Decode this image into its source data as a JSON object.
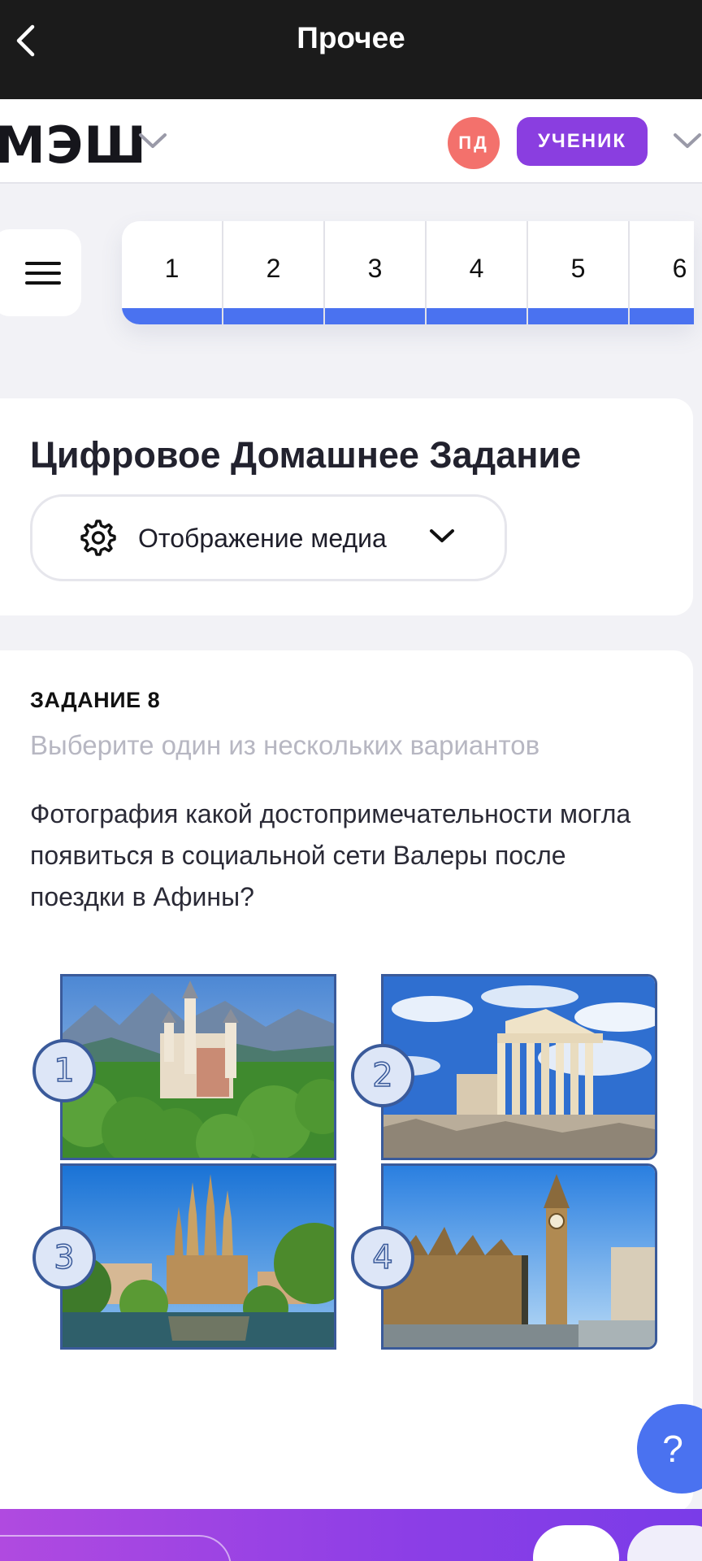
{
  "topbar": {
    "title": "Прочее"
  },
  "header": {
    "logo": "МЭШ",
    "avatar_initials": "ПД",
    "role": "УЧЕНИК"
  },
  "tabs": [
    "1",
    "2",
    "3",
    "4",
    "5",
    "6"
  ],
  "homework": {
    "title": "Цифровое Домашнее Задание",
    "media_display_label": "Отображение медиа"
  },
  "task": {
    "label": "ЗАДАНИЕ 8",
    "hint": "Выберите один из нескольких вариантов",
    "question": "Фотография какой достопримечательности могла появиться в социальной сети Валеры после поездки в Афины?",
    "options": [
      "1",
      "2",
      "3",
      "4"
    ]
  },
  "help": {
    "label": "?"
  },
  "colors": {
    "accent": "#4a72f0",
    "role_badge": "#8a3ee0",
    "avatar": "#f3716c",
    "topbar": "#1b1b1b"
  }
}
